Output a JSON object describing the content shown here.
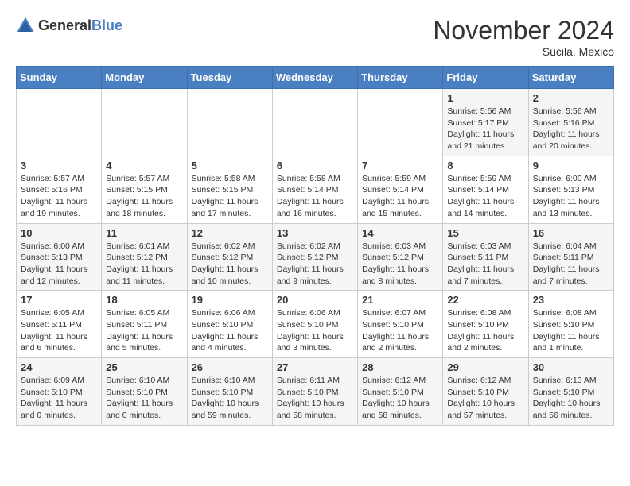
{
  "header": {
    "logo_general": "General",
    "logo_blue": "Blue",
    "month": "November 2024",
    "location": "Sucila, Mexico"
  },
  "weekdays": [
    "Sunday",
    "Monday",
    "Tuesday",
    "Wednesday",
    "Thursday",
    "Friday",
    "Saturday"
  ],
  "weeks": [
    [
      {
        "day": "",
        "sunrise": "",
        "sunset": "",
        "daylight": ""
      },
      {
        "day": "",
        "sunrise": "",
        "sunset": "",
        "daylight": ""
      },
      {
        "day": "",
        "sunrise": "",
        "sunset": "",
        "daylight": ""
      },
      {
        "day": "",
        "sunrise": "",
        "sunset": "",
        "daylight": ""
      },
      {
        "day": "",
        "sunrise": "",
        "sunset": "",
        "daylight": ""
      },
      {
        "day": "1",
        "sunrise": "Sunrise: 5:56 AM",
        "sunset": "Sunset: 5:17 PM",
        "daylight": "Daylight: 11 hours and 21 minutes."
      },
      {
        "day": "2",
        "sunrise": "Sunrise: 5:56 AM",
        "sunset": "Sunset: 5:16 PM",
        "daylight": "Daylight: 11 hours and 20 minutes."
      }
    ],
    [
      {
        "day": "3",
        "sunrise": "Sunrise: 5:57 AM",
        "sunset": "Sunset: 5:16 PM",
        "daylight": "Daylight: 11 hours and 19 minutes."
      },
      {
        "day": "4",
        "sunrise": "Sunrise: 5:57 AM",
        "sunset": "Sunset: 5:15 PM",
        "daylight": "Daylight: 11 hours and 18 minutes."
      },
      {
        "day": "5",
        "sunrise": "Sunrise: 5:58 AM",
        "sunset": "Sunset: 5:15 PM",
        "daylight": "Daylight: 11 hours and 17 minutes."
      },
      {
        "day": "6",
        "sunrise": "Sunrise: 5:58 AM",
        "sunset": "Sunset: 5:14 PM",
        "daylight": "Daylight: 11 hours and 16 minutes."
      },
      {
        "day": "7",
        "sunrise": "Sunrise: 5:59 AM",
        "sunset": "Sunset: 5:14 PM",
        "daylight": "Daylight: 11 hours and 15 minutes."
      },
      {
        "day": "8",
        "sunrise": "Sunrise: 5:59 AM",
        "sunset": "Sunset: 5:14 PM",
        "daylight": "Daylight: 11 hours and 14 minutes."
      },
      {
        "day": "9",
        "sunrise": "Sunrise: 6:00 AM",
        "sunset": "Sunset: 5:13 PM",
        "daylight": "Daylight: 11 hours and 13 minutes."
      }
    ],
    [
      {
        "day": "10",
        "sunrise": "Sunrise: 6:00 AM",
        "sunset": "Sunset: 5:13 PM",
        "daylight": "Daylight: 11 hours and 12 minutes."
      },
      {
        "day": "11",
        "sunrise": "Sunrise: 6:01 AM",
        "sunset": "Sunset: 5:12 PM",
        "daylight": "Daylight: 11 hours and 11 minutes."
      },
      {
        "day": "12",
        "sunrise": "Sunrise: 6:02 AM",
        "sunset": "Sunset: 5:12 PM",
        "daylight": "Daylight: 11 hours and 10 minutes."
      },
      {
        "day": "13",
        "sunrise": "Sunrise: 6:02 AM",
        "sunset": "Sunset: 5:12 PM",
        "daylight": "Daylight: 11 hours and 9 minutes."
      },
      {
        "day": "14",
        "sunrise": "Sunrise: 6:03 AM",
        "sunset": "Sunset: 5:12 PM",
        "daylight": "Daylight: 11 hours and 8 minutes."
      },
      {
        "day": "15",
        "sunrise": "Sunrise: 6:03 AM",
        "sunset": "Sunset: 5:11 PM",
        "daylight": "Daylight: 11 hours and 7 minutes."
      },
      {
        "day": "16",
        "sunrise": "Sunrise: 6:04 AM",
        "sunset": "Sunset: 5:11 PM",
        "daylight": "Daylight: 11 hours and 7 minutes."
      }
    ],
    [
      {
        "day": "17",
        "sunrise": "Sunrise: 6:05 AM",
        "sunset": "Sunset: 5:11 PM",
        "daylight": "Daylight: 11 hours and 6 minutes."
      },
      {
        "day": "18",
        "sunrise": "Sunrise: 6:05 AM",
        "sunset": "Sunset: 5:11 PM",
        "daylight": "Daylight: 11 hours and 5 minutes."
      },
      {
        "day": "19",
        "sunrise": "Sunrise: 6:06 AM",
        "sunset": "Sunset: 5:10 PM",
        "daylight": "Daylight: 11 hours and 4 minutes."
      },
      {
        "day": "20",
        "sunrise": "Sunrise: 6:06 AM",
        "sunset": "Sunset: 5:10 PM",
        "daylight": "Daylight: 11 hours and 3 minutes."
      },
      {
        "day": "21",
        "sunrise": "Sunrise: 6:07 AM",
        "sunset": "Sunset: 5:10 PM",
        "daylight": "Daylight: 11 hours and 2 minutes."
      },
      {
        "day": "22",
        "sunrise": "Sunrise: 6:08 AM",
        "sunset": "Sunset: 5:10 PM",
        "daylight": "Daylight: 11 hours and 2 minutes."
      },
      {
        "day": "23",
        "sunrise": "Sunrise: 6:08 AM",
        "sunset": "Sunset: 5:10 PM",
        "daylight": "Daylight: 11 hours and 1 minute."
      }
    ],
    [
      {
        "day": "24",
        "sunrise": "Sunrise: 6:09 AM",
        "sunset": "Sunset: 5:10 PM",
        "daylight": "Daylight: 11 hours and 0 minutes."
      },
      {
        "day": "25",
        "sunrise": "Sunrise: 6:10 AM",
        "sunset": "Sunset: 5:10 PM",
        "daylight": "Daylight: 11 hours and 0 minutes."
      },
      {
        "day": "26",
        "sunrise": "Sunrise: 6:10 AM",
        "sunset": "Sunset: 5:10 PM",
        "daylight": "Daylight: 10 hours and 59 minutes."
      },
      {
        "day": "27",
        "sunrise": "Sunrise: 6:11 AM",
        "sunset": "Sunset: 5:10 PM",
        "daylight": "Daylight: 10 hours and 58 minutes."
      },
      {
        "day": "28",
        "sunrise": "Sunrise: 6:12 AM",
        "sunset": "Sunset: 5:10 PM",
        "daylight": "Daylight: 10 hours and 58 minutes."
      },
      {
        "day": "29",
        "sunrise": "Sunrise: 6:12 AM",
        "sunset": "Sunset: 5:10 PM",
        "daylight": "Daylight: 10 hours and 57 minutes."
      },
      {
        "day": "30",
        "sunrise": "Sunrise: 6:13 AM",
        "sunset": "Sunset: 5:10 PM",
        "daylight": "Daylight: 10 hours and 56 minutes."
      }
    ]
  ]
}
